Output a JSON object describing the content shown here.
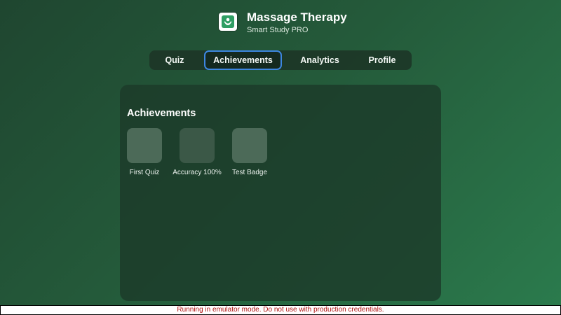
{
  "header": {
    "logo_icon": "massage-hands-icon",
    "title": "Massage Therapy",
    "subtitle": "Smart Study PRO"
  },
  "tabs": {
    "active": "Achievements",
    "items": [
      {
        "label": "Quiz"
      },
      {
        "label": "Achievements"
      },
      {
        "label": "Analytics"
      },
      {
        "label": "Profile"
      }
    ]
  },
  "achievements": {
    "heading": "Achievements",
    "badges": [
      {
        "label": "First Quiz"
      },
      {
        "label": "Accuracy 100%"
      },
      {
        "label": "Test Badge"
      }
    ]
  },
  "banner": {
    "text": "Running in emulator mode. Do not use with production credentials."
  },
  "colors": {
    "accent": "#3d86e0",
    "banner_text": "#b01010",
    "logo_green": "#2f9e63"
  }
}
